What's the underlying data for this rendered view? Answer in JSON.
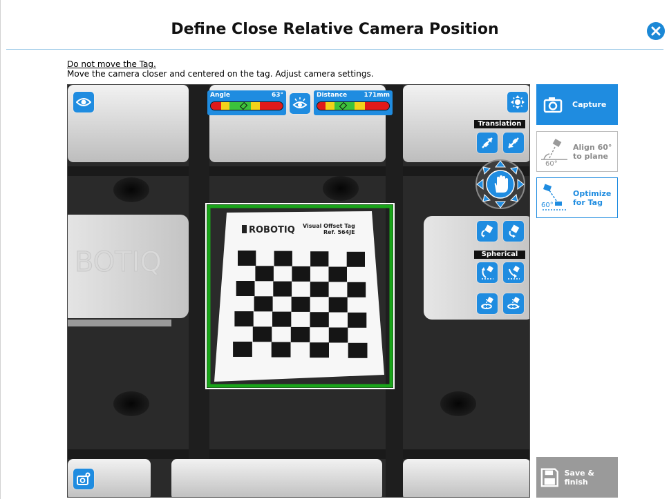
{
  "header": {
    "title": "Define Close Relative Camera Position"
  },
  "instructions": {
    "line1": "Do not move the Tag.",
    "line2": "Move the camera closer and centered on the tag. Adjust camera settings."
  },
  "camera": {
    "tag_brand": "ROBOTIQ",
    "tag_title": "Visual Offset Tag",
    "tag_ref": "Ref. 564JE",
    "side_text": "BOTIQ"
  },
  "gauges": {
    "angle": {
      "label": "Angle",
      "value": "63°"
    },
    "distance": {
      "label": "Distance",
      "value": "171mm"
    }
  },
  "controls": {
    "translation_label": "Translation",
    "spherical_label": "Spherical"
  },
  "actions": {
    "capture": "Capture",
    "align": "Align 60°\nto plane",
    "align_icon_text": "60°",
    "optimize": "Optimize\nfor Tag",
    "optimize_icon_text": "60°",
    "save": "Save & finish"
  },
  "colors": {
    "accent": "#1f8ce0",
    "gauge_red": "#e01a1a",
    "gauge_yellow": "#f2d21a",
    "gauge_green": "#3cc23c",
    "tag_frame_green": "#1aa51a"
  }
}
